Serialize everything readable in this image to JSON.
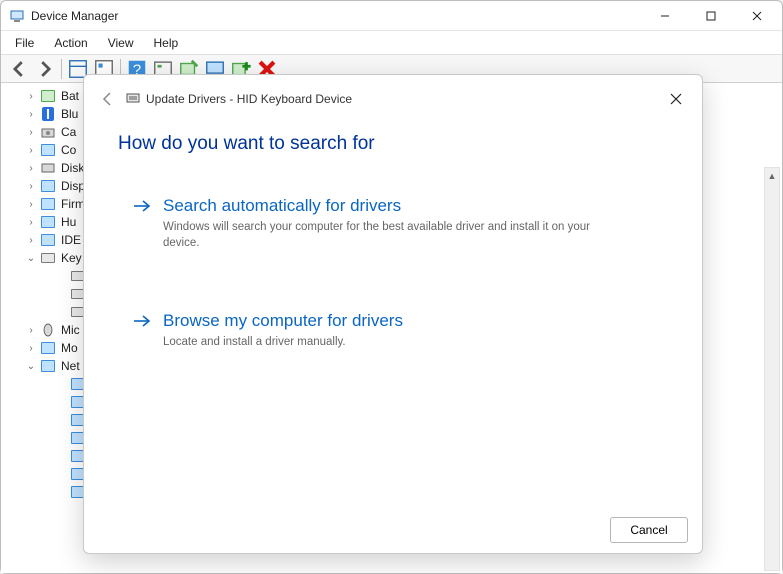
{
  "window": {
    "title": "Device Manager"
  },
  "menu": {
    "file": "File",
    "action": "Action",
    "view": "View",
    "help": "Help"
  },
  "toolbar_icons": {
    "back": "back-icon",
    "forward": "forward-icon",
    "show_hide": "show-hide-icon",
    "properties": "properties-icon",
    "help": "help-icon",
    "update": "update-driver-icon",
    "uninstall": "scan-hardware-icon",
    "scan": "monitor-icon",
    "add": "add-hardware-icon",
    "remove": "remove-icon"
  },
  "tree": {
    "items": [
      {
        "label": "Bat",
        "expand": "collapsed",
        "icon": "battery-icon",
        "indent": 1
      },
      {
        "label": "Blu",
        "expand": "collapsed",
        "icon": "bluetooth-icon",
        "indent": 1
      },
      {
        "label": "Ca",
        "expand": "collapsed",
        "icon": "camera-icon",
        "indent": 1
      },
      {
        "label": "Co",
        "expand": "collapsed",
        "icon": "computer-icon",
        "indent": 1
      },
      {
        "label": "Disk",
        "expand": "collapsed",
        "icon": "disk-icon",
        "indent": 1
      },
      {
        "label": "Disp",
        "expand": "collapsed",
        "icon": "display-icon",
        "indent": 1
      },
      {
        "label": "Firm",
        "expand": "collapsed",
        "icon": "firmware-icon",
        "indent": 1
      },
      {
        "label": "Hu",
        "expand": "collapsed",
        "icon": "hid-icon",
        "indent": 1
      },
      {
        "label": "IDE",
        "expand": "collapsed",
        "icon": "ide-icon",
        "indent": 1
      },
      {
        "label": "Key",
        "expand": "expanded",
        "icon": "keyboard-icon",
        "indent": 1
      },
      {
        "label": "",
        "expand": "none",
        "icon": "keyboard-device-icon",
        "indent": 2
      },
      {
        "label": "",
        "expand": "none",
        "icon": "keyboard-device-icon",
        "indent": 2
      },
      {
        "label": "",
        "expand": "none",
        "icon": "keyboard-device-icon",
        "indent": 2
      },
      {
        "label": "Mic",
        "expand": "collapsed",
        "icon": "mouse-icon",
        "indent": 1
      },
      {
        "label": "Mo",
        "expand": "collapsed",
        "icon": "monitor-icon",
        "indent": 1
      },
      {
        "label": "Net",
        "expand": "expanded",
        "icon": "network-icon",
        "indent": 1
      },
      {
        "label": "",
        "expand": "none",
        "icon": "network-adapter-icon",
        "indent": 2
      },
      {
        "label": "",
        "expand": "none",
        "icon": "network-adapter-icon",
        "indent": 2
      },
      {
        "label": "",
        "expand": "none",
        "icon": "network-adapter-icon",
        "indent": 2
      },
      {
        "label": "",
        "expand": "none",
        "icon": "network-adapter-icon",
        "indent": 2
      },
      {
        "label": "",
        "expand": "none",
        "icon": "network-adapter-icon",
        "indent": 2
      },
      {
        "label": "",
        "expand": "none",
        "icon": "network-adapter-icon",
        "indent": 2
      },
      {
        "label": "",
        "expand": "none",
        "icon": "network-adapter-icon",
        "indent": 2
      }
    ]
  },
  "dialog": {
    "title": "Update Drivers - HID Keyboard Device",
    "heading": "How do you want to search for",
    "options": [
      {
        "title": "Search automatically for drivers",
        "desc": "Windows will search your computer for the best available driver and install it on your device."
      },
      {
        "title": "Browse my computer for drivers",
        "desc": "Locate and install a driver manually."
      }
    ],
    "cancel": "Cancel"
  }
}
